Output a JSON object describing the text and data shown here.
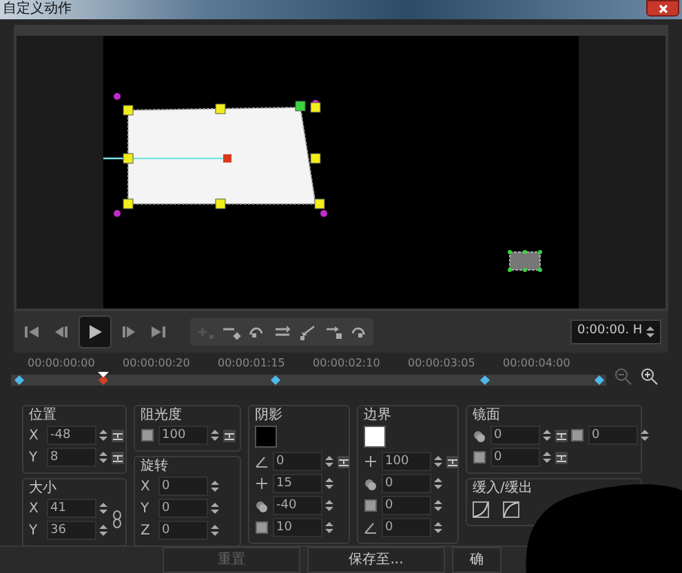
{
  "window": {
    "title": "自定义动作"
  },
  "timecode": "0:00:00. H",
  "timeline": {
    "ticks": [
      "00:00:00:00",
      "00:00:00:20",
      "00:00:01:15",
      "00:00:02:10",
      "00:00:03:05",
      "00:00:04:00"
    ]
  },
  "columns": [
    [
      {
        "title": "位置",
        "rows": [
          [
            {
              "kind": "axis",
              "label": "X",
              "value": "-48",
              "reset": true
            }
          ],
          [
            {
              "kind": "axis",
              "label": "Y",
              "value": "8",
              "reset": true
            }
          ]
        ]
      },
      {
        "title": "大小",
        "linked": true,
        "rows": [
          [
            {
              "kind": "axis",
              "label": "X",
              "value": "41",
              "reset": false
            }
          ],
          [
            {
              "kind": "axis",
              "label": "Y",
              "value": "36",
              "reset": false
            }
          ]
        ]
      }
    ],
    [
      {
        "title": "阻光度",
        "rows": [
          [
            {
              "kind": "icon",
              "value": "100",
              "reset": true
            }
          ]
        ]
      },
      {
        "title": "旋转",
        "rows": [
          [
            {
              "kind": "axis",
              "label": "X",
              "value": "0",
              "reset": false
            }
          ],
          [
            {
              "kind": "axis",
              "label": "Y",
              "value": "0",
              "reset": false
            }
          ],
          [
            {
              "kind": "axis",
              "label": "Z",
              "value": "0",
              "reset": false
            }
          ]
        ]
      }
    ],
    [
      {
        "title": "阴影",
        "color": "#000000",
        "rows": [
          [
            {
              "kind": "icon",
              "value": "0",
              "reset": true
            }
          ],
          [
            {
              "kind": "icon",
              "value": "15",
              "reset": false
            }
          ],
          [
            {
              "kind": "icon",
              "value": "-40",
              "reset": false
            }
          ],
          [
            {
              "kind": "icon",
              "value": "10",
              "reset": false
            }
          ]
        ]
      }
    ],
    [
      {
        "title": "边界",
        "color": "#ffffff",
        "rows": [
          [
            {
              "kind": "icon",
              "value": "100",
              "reset": true
            }
          ],
          [
            {
              "kind": "icon",
              "value": "0",
              "reset": false
            }
          ],
          [
            {
              "kind": "icon",
              "value": "0",
              "reset": false
            }
          ],
          [
            {
              "kind": "icon",
              "value": "0",
              "reset": false
            }
          ]
        ]
      }
    ],
    [
      {
        "title": "镜面",
        "rows": [
          [
            {
              "kind": "icon",
              "value": "0",
              "reset": true
            },
            {
              "kind": "icon",
              "value": "0",
              "reset": false
            }
          ],
          [
            {
              "kind": "icon",
              "value": "0",
              "reset": true
            }
          ]
        ]
      },
      {
        "title": "缓入/缓出",
        "kind": "ease"
      }
    ]
  ],
  "buttons": [
    {
      "label": "重置",
      "disabled": true
    },
    {
      "label": "保存至...",
      "disabled": false
    },
    {
      "label": "确",
      "disabled": false
    }
  ]
}
